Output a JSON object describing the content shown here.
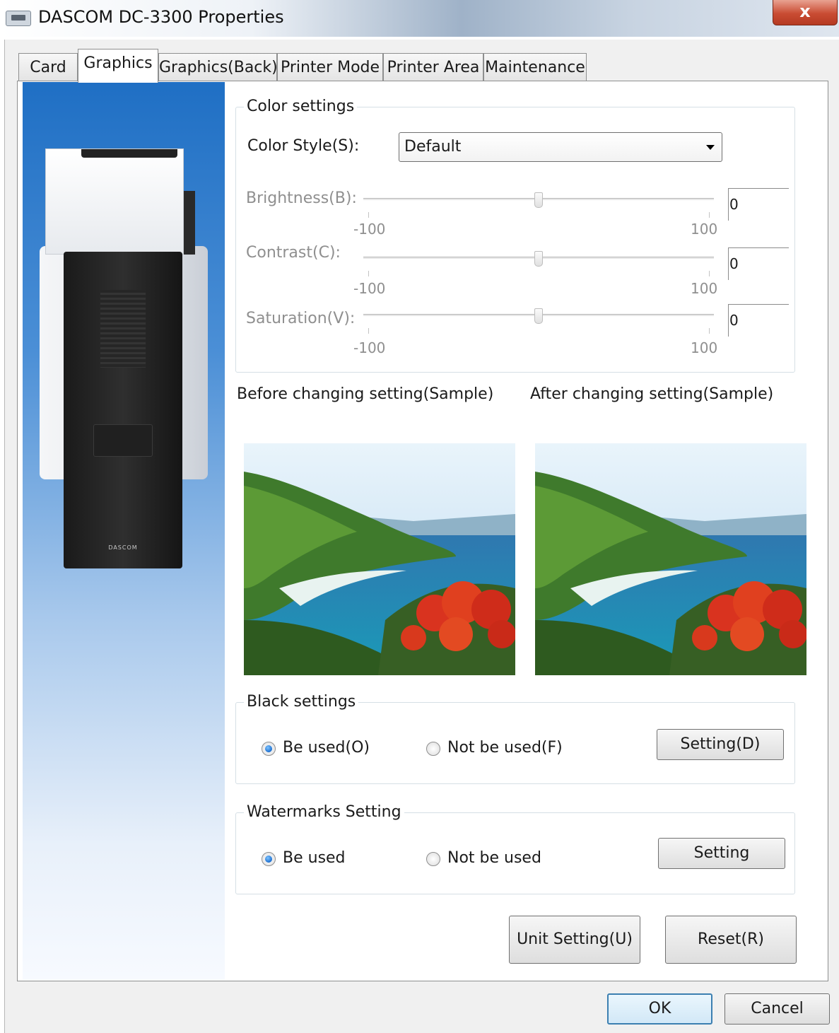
{
  "window": {
    "title": "DASCOM DC-3300 Properties",
    "close_label": "x"
  },
  "tabs": [
    {
      "label": "Card",
      "active": false
    },
    {
      "label": "Graphics",
      "active": true
    },
    {
      "label": "Graphics(Back)",
      "active": false
    },
    {
      "label": "Printer Mode",
      "active": false
    },
    {
      "label": "Printer Area",
      "active": false
    },
    {
      "label": "Maintenance",
      "active": false
    }
  ],
  "side_image": {
    "brand_text": "DASCOM"
  },
  "color_settings": {
    "group_title": "Color settings",
    "color_style_label": "Color Style(S):",
    "color_style_value": "Default",
    "sliders": [
      {
        "label": "Brightness(B):",
        "value": "0",
        "min_label": "-100",
        "max_label": "100",
        "level": 0
      },
      {
        "label": "Contrast(C):",
        "value": "0",
        "min_label": "-100",
        "max_label": "100",
        "level": 0
      },
      {
        "label": "Saturation(V):",
        "value": "0",
        "min_label": "-100",
        "max_label": "100",
        "level": 0
      }
    ]
  },
  "samples": {
    "before_label": "Before changing setting(Sample)",
    "after_label": "After changing setting(Sample)"
  },
  "black_settings": {
    "group_title": "Black settings",
    "option_used": "Be used(O)",
    "option_not_used": "Not be used(F)",
    "selected": "used",
    "button": "Setting(D)"
  },
  "watermarks": {
    "group_title": "Watermarks Setting",
    "option_used": "Be used",
    "option_not_used": "Not be used",
    "selected": "used",
    "button": "Setting"
  },
  "buttons": {
    "unit_setting": "Unit Setting(U)",
    "reset": "Reset(R)",
    "ok": "OK",
    "cancel": "Cancel"
  },
  "colors": {
    "accent": "#1d6fd0",
    "side_gradient_top": "#1f6fc4"
  }
}
